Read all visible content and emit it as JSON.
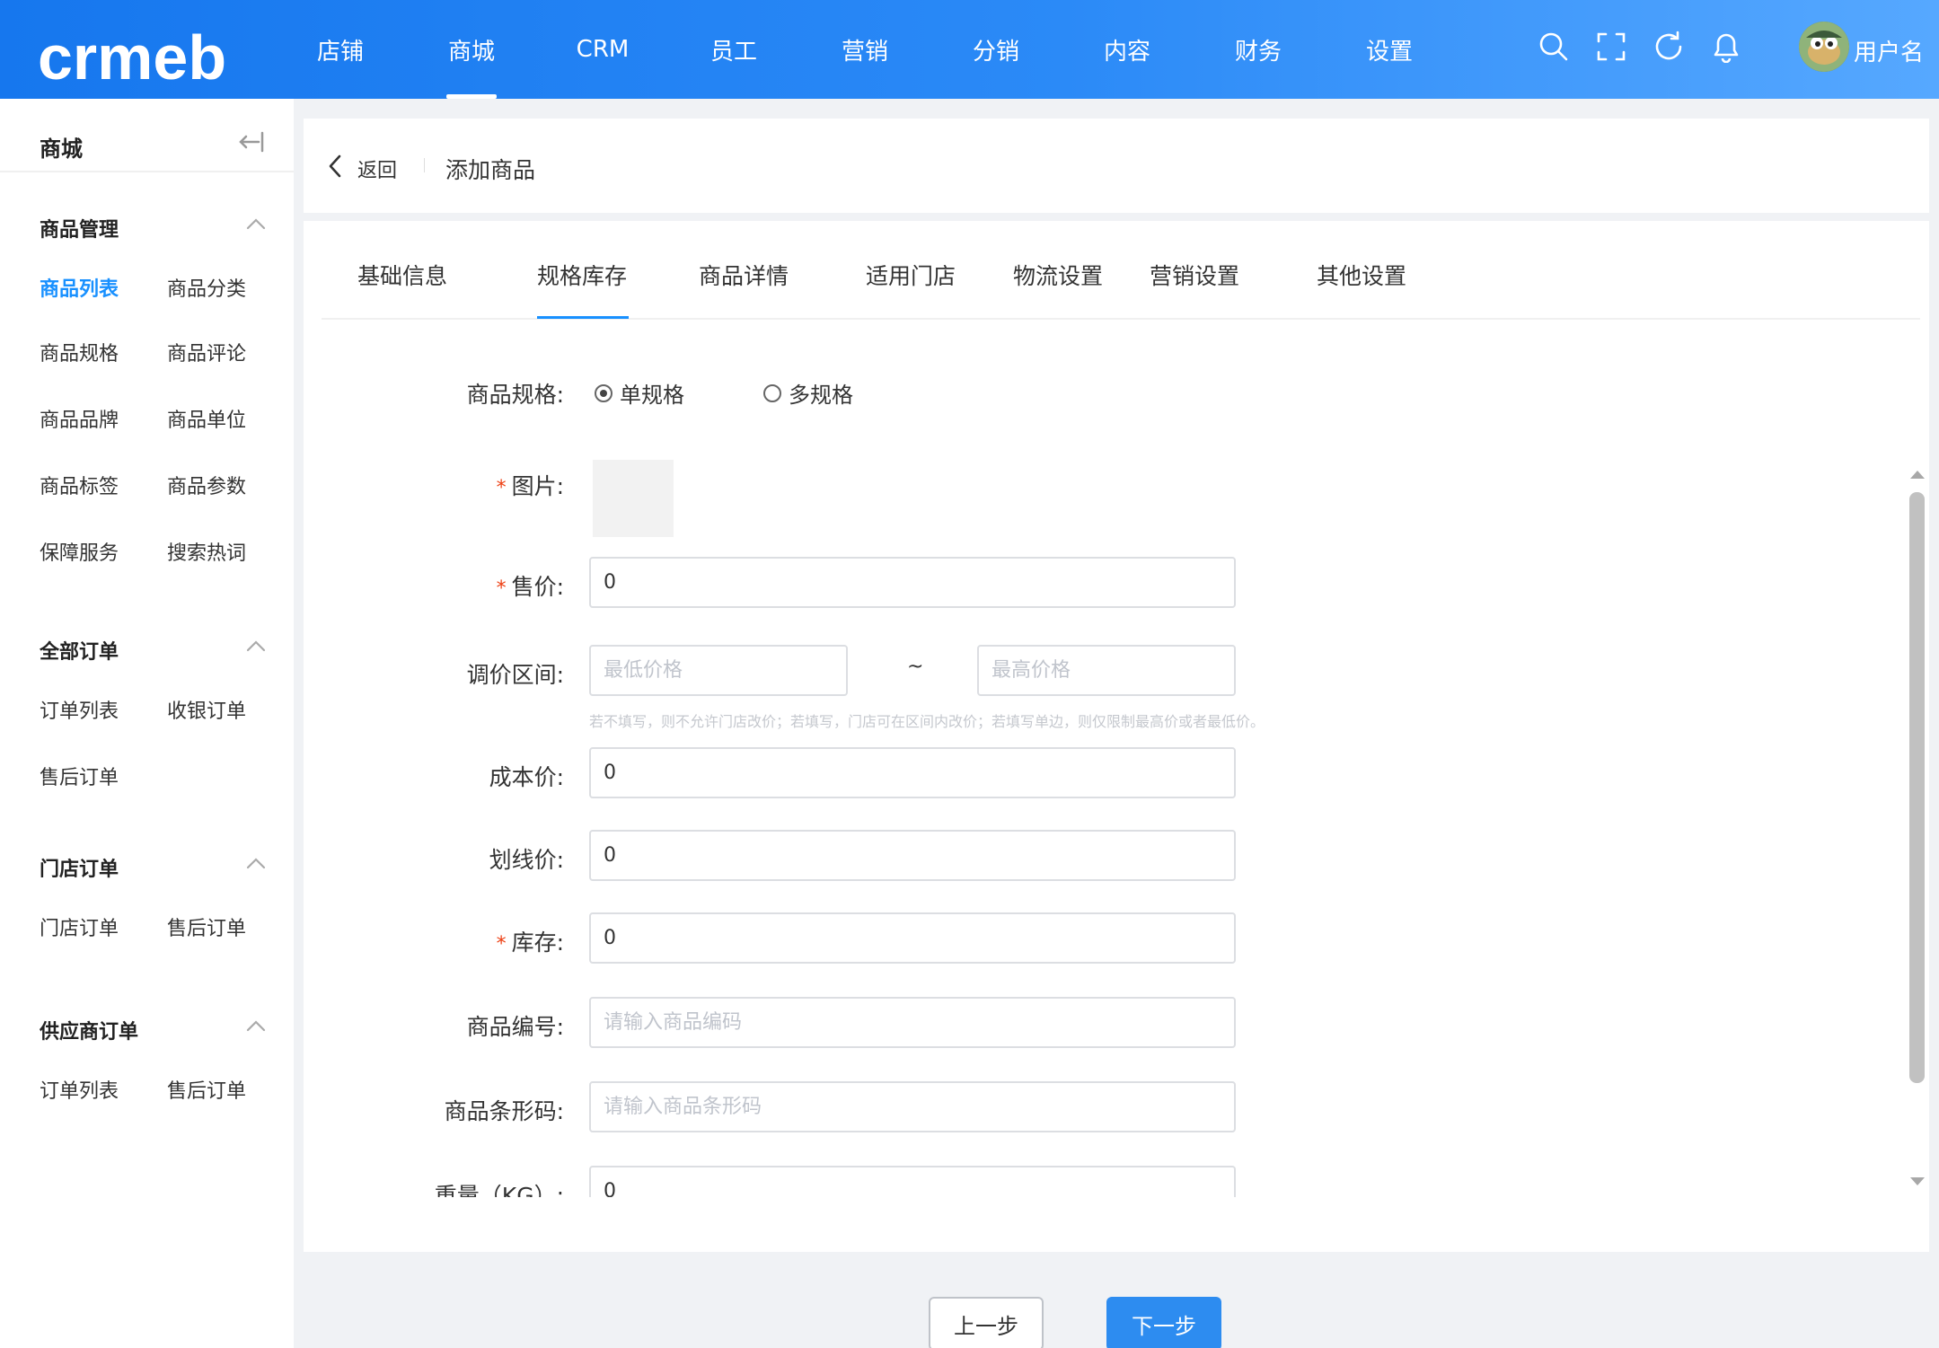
{
  "header": {
    "logo_text": "crmeb",
    "nav": [
      {
        "label": "店铺",
        "active": false
      },
      {
        "label": "商城",
        "active": true
      },
      {
        "label": "CRM",
        "active": false
      },
      {
        "label": "员工",
        "active": false
      },
      {
        "label": "营销",
        "active": false
      },
      {
        "label": "分销",
        "active": false
      },
      {
        "label": "内容",
        "active": false
      },
      {
        "label": "财务",
        "active": false
      },
      {
        "label": "设置",
        "active": false
      }
    ],
    "icons": [
      "search-icon",
      "fullscreen-icon",
      "refresh-icon",
      "bell-icon"
    ],
    "username": "用户名",
    "colors": {
      "bar_start": "#1677ee",
      "bar_end": "#56a8ff"
    }
  },
  "sidebar": {
    "title": "商城",
    "groups": [
      {
        "title": "商品管理",
        "items": [
          "商品列表",
          "商品分类",
          "商品规格",
          "商品评论",
          "商品品牌",
          "商品单位",
          "商品标签",
          "商品参数",
          "保障服务",
          "搜索热词"
        ],
        "active_index": 0
      },
      {
        "title": "全部订单",
        "items": [
          "订单列表",
          "收银订单",
          "售后订单"
        ]
      },
      {
        "title": "门店订单",
        "items": [
          "门店订单",
          "售后订单"
        ]
      },
      {
        "title": "供应商订单",
        "items": [
          "订单列表",
          "售后订单"
        ]
      }
    ],
    "accent_color": "#1890ff"
  },
  "breadcrumb": {
    "back_label": "返回",
    "title": "添加商品"
  },
  "tabs": [
    "基础信息",
    "规格库存",
    "商品详情",
    "适用门店",
    "物流设置",
    "营销设置",
    "其他设置"
  ],
  "active_tab": "规格库存",
  "form": {
    "spec_label": "商品规格:",
    "spec_options": [
      "单规格",
      "多规格"
    ],
    "spec_selected": "单规格",
    "image_label": "图片:",
    "price_label": "售价:",
    "price_value": "0",
    "range_label": "调价区间:",
    "range_min_placeholder": "最低价格",
    "range_sep": "~",
    "range_max_placeholder": "最高价格",
    "range_hint": "若不填写，则不允许门店改价；若填写，门店可在区间内改价；若填写单边，则仅限制最高价或者最低价。",
    "cost_label": "成本价:",
    "cost_value": "0",
    "line_price_label": "划线价:",
    "line_price_value": "0",
    "stock_label": "库存:",
    "stock_value": "0",
    "code_label": "商品编号:",
    "code_placeholder": "请输入商品编码",
    "barcode_label": "商品条形码:",
    "barcode_placeholder": "请输入商品条形码",
    "weight_label": "重量（KG）:",
    "weight_value": "0",
    "required_mark": "*"
  },
  "footer": {
    "prev_label": "上一步",
    "next_label": "下一步",
    "primary_color": "#2d8cf0"
  }
}
